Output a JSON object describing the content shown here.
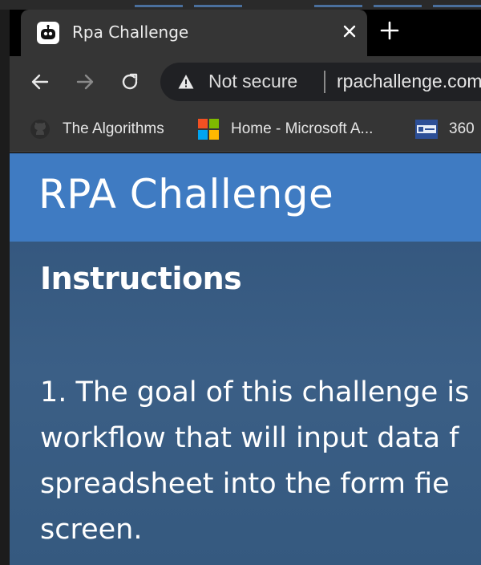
{
  "browser": {
    "tab": {
      "title": "Rpa Challenge",
      "favicon": "robot-icon",
      "close_icon": "close-icon"
    },
    "new_tab_icon": "plus-icon",
    "toolbar": {
      "back_icon": "back-arrow-icon",
      "forward_icon": "forward-arrow-icon",
      "reload_icon": "reload-icon",
      "security_icon": "warning-icon",
      "security_text": "Not secure",
      "url": "rpachallenge.com"
    },
    "bookmarks": [
      {
        "label": "The Algorithms",
        "icon": "github-icon"
      },
      {
        "label": "Home - Microsoft A...",
        "icon": "microsoft-icon"
      },
      {
        "label": "360",
        "icon": "site-360-icon"
      }
    ]
  },
  "page": {
    "header_title": "RPA Challenge",
    "header_color": "#3f7bc2",
    "instructions": {
      "heading": "Instructions",
      "lines": [
        "1. The goal of this challenge is",
        "workflow that will input data f",
        "spreadsheet into the form fie",
        "screen."
      ]
    }
  }
}
